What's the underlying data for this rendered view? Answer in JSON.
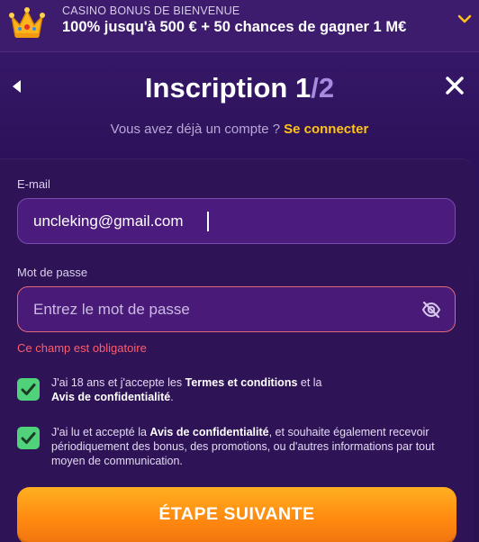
{
  "banner": {
    "kicker": "CASINO BONUS DE BIENVENUE",
    "title": "100% jusqu'à 500 € + 50 chances de gagner 1 M€",
    "icon": "crown-icon",
    "expand_icon": "chevron-down-icon"
  },
  "header": {
    "title_main": "Inscription 1",
    "title_sep": "/",
    "title_total": "2",
    "back_icon": "chevron-left-icon",
    "close_icon": "close-icon",
    "login_prompt": "Vous avez déjà un compte ?",
    "login_link": "Se connecter"
  },
  "form": {
    "email_label": "E-mail",
    "email_value": "uncleking@gmail.com",
    "password_label": "Mot de passe",
    "password_placeholder": "Entrez le mot de passe",
    "password_value": "",
    "password_visibility_icon": "eye-off-icon",
    "password_error": "Ce champ est obligatoire",
    "consent_terms": {
      "checked": true,
      "text_before": "J'ai 18 ans et j'accepte les ",
      "link1": "Termes et conditions",
      "text_mid": " et la ",
      "link2": "Avis de confidentialité",
      "text_after": "."
    },
    "consent_marketing": {
      "checked": true,
      "text_before": "J'ai lu et accepté la ",
      "link": "Avis de confidentialité",
      "text_after": ", et souhaite également recevoir périodiquement des bonus, des promotions, ou d'autres informations par tout moyen de communication."
    },
    "submit_label": "ÉTAPE SUIVANTE"
  },
  "colors": {
    "background": "#2a1150",
    "accent_link": "#ffc21a",
    "error": "#ff5c6c",
    "checkbox": "#4fd27a",
    "button": "#ff9a18"
  }
}
